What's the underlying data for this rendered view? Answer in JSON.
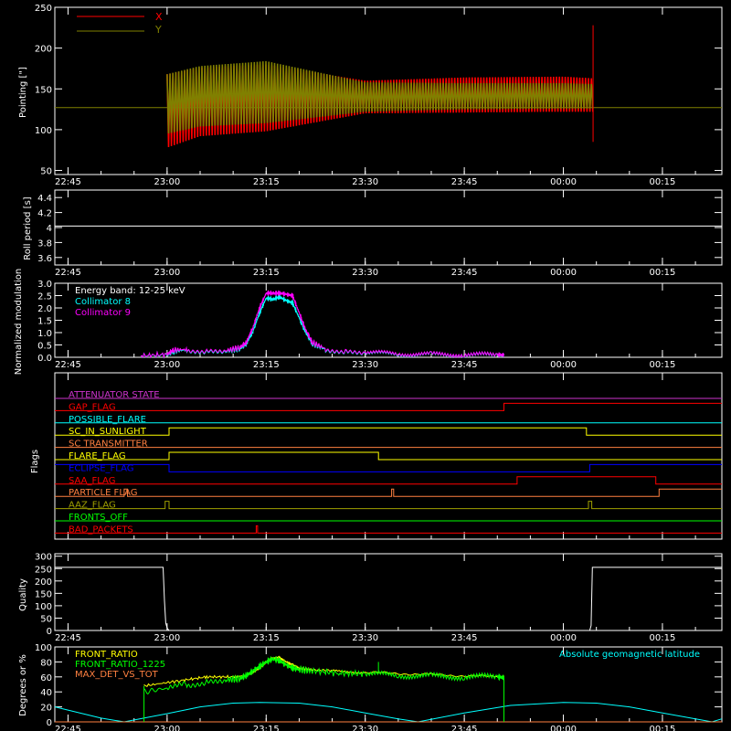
{
  "time_ticks": [
    "22:45",
    "23:00",
    "23:15",
    "23:30",
    "23:45",
    "00:00",
    "00:15"
  ],
  "colors": {
    "x": "#ff0000",
    "y": "#808000",
    "white": "#ffffff",
    "cyan": "#00ffff",
    "magenta": "#ff00ff",
    "green": "#00ff00",
    "yellow": "#ffff00",
    "orange": "#ff8040",
    "blue": "#0000ff",
    "purple": "#cc33cc",
    "olive": "#a0a000"
  },
  "chart_data": [
    {
      "id": "pointing",
      "type": "line",
      "ylabel": "Pointing [\"]",
      "ylim": [
        45,
        250
      ],
      "yticks": [
        50,
        100,
        150,
        200,
        250
      ],
      "x_range_minutes": [
        -17,
        84
      ],
      "series": [
        {
          "name": "X",
          "color": "#ff0000",
          "band": {
            "x": [
              0,
              5,
              15,
              30,
              45,
              60,
              64.5
            ],
            "lower": [
              78,
              92,
              98,
              120,
              121,
              122,
              122
            ],
            "upper": [
              168,
              176,
              180,
              160,
              164,
              165,
              163
            ]
          }
        },
        {
          "name": "Y",
          "color": "#808000",
          "band": {
            "x": [
              0,
              5,
              15,
              30,
              45,
              60,
              64.5
            ],
            "lower": [
              95,
              104,
              108,
              122,
              125,
              126,
              126
            ],
            "upper": [
              168,
              178,
              184,
              158,
              157,
              157,
              156
            ]
          }
        }
      ],
      "reference_line": 127,
      "spike": {
        "x": 64.5,
        "min": 85,
        "max": 228
      }
    },
    {
      "id": "roll-period",
      "type": "line",
      "ylabel": "Roll period [s]",
      "ylim": [
        3.5,
        4.5
      ],
      "yticks": [
        3.6,
        3.8,
        4.0,
        4.2,
        4.4
      ],
      "series": [
        {
          "color": "#ffffff",
          "x": [
            -17,
            84
          ],
          "y": [
            4.02,
            4.02
          ]
        }
      ]
    },
    {
      "id": "modulation",
      "type": "line",
      "ylabel": "Normalized modulation",
      "ylim": [
        0,
        3
      ],
      "yticks": [
        "0.0",
        "0.5",
        "1.0",
        "1.5",
        "2.0",
        "2.5",
        "3.0"
      ],
      "annotation": "Energy band: 12-25 keV",
      "series": [
        {
          "name": "Collimator 8",
          "color": "#00ffff",
          "x": [
            -4,
            0,
            1,
            3,
            6,
            9,
            11,
            12,
            13,
            14,
            15,
            16,
            17,
            18,
            19,
            20,
            21,
            22,
            24,
            27,
            30,
            35,
            40,
            45,
            50,
            51
          ],
          "y": [
            0.05,
            0.1,
            0.25,
            0.3,
            0.22,
            0.25,
            0.35,
            0.55,
            1.05,
            1.8,
            2.4,
            2.35,
            2.45,
            2.3,
            2.2,
            1.6,
            1.0,
            0.55,
            0.32,
            0.22,
            0.18,
            0.13,
            0.11,
            0.1,
            0.09,
            0.08
          ]
        },
        {
          "name": "Collimator 9",
          "color": "#ff00ff",
          "x": [
            -4,
            0,
            1,
            3,
            6,
            9,
            11,
            12,
            13,
            14,
            15,
            16,
            17,
            18,
            19,
            20,
            21,
            22,
            24,
            27,
            30,
            35,
            40,
            45,
            50,
            51
          ],
          "y": [
            0.05,
            0.12,
            0.3,
            0.32,
            0.25,
            0.28,
            0.4,
            0.6,
            1.2,
            2.0,
            2.6,
            2.6,
            2.6,
            2.55,
            2.5,
            1.8,
            1.1,
            0.6,
            0.35,
            0.24,
            0.2,
            0.15,
            0.12,
            0.11,
            0.1,
            0.09
          ]
        }
      ]
    },
    {
      "id": "flags",
      "type": "line",
      "ylabel": "Flags",
      "flags": [
        {
          "name": "ATTENUATOR STATE",
          "color": "#cc33cc",
          "steps": [
            [
              -17,
              0
            ]
          ]
        },
        {
          "name": "GAP_FLAG",
          "color": "#ff0000",
          "steps": [
            [
              -17,
              0
            ],
            [
              51,
              1
            ]
          ]
        },
        {
          "name": "POSSIBLE_FLARE",
          "color": "#00ffff",
          "steps": [
            [
              -17,
              0
            ]
          ]
        },
        {
          "name": "SC_IN_SUNLIGHT",
          "color": "#ffff00",
          "steps": [
            [
              -17,
              0
            ],
            [
              0.3,
              1
            ],
            [
              63.5,
              0
            ]
          ]
        },
        {
          "name": "SC TRANSMITTER",
          "color": "#ff8040",
          "steps": [
            [
              -17,
              0
            ]
          ]
        },
        {
          "name": "FLARE_FLAG",
          "color": "#ffff00",
          "steps": [
            [
              -17,
              0
            ],
            [
              0.3,
              1
            ],
            [
              32,
              0
            ]
          ]
        },
        {
          "name": "ECLIPSE_FLAG",
          "color": "#0000ff",
          "steps": [
            [
              -17,
              1
            ],
            [
              0.3,
              0
            ],
            [
              64,
              1
            ]
          ]
        },
        {
          "name": "SAA_FLAG",
          "color": "#ff0000",
          "steps": [
            [
              -17,
              0
            ],
            [
              53,
              1
            ],
            [
              74,
              0
            ]
          ]
        },
        {
          "name": "PARTICLE FLAG",
          "color": "#ff8040",
          "steps": [
            [
              -17,
              0
            ],
            [
              -6.5,
              1
            ],
            [
              -6,
              0
            ],
            [
              34,
              1
            ],
            [
              34.3,
              0
            ],
            [
              74.5,
              1
            ],
            [
              84,
              1
            ]
          ]
        },
        {
          "name": "AAZ_FLAG",
          "color": "#a0a000",
          "steps": [
            [
              -17,
              0
            ],
            [
              -0.3,
              1
            ],
            [
              0.3,
              0
            ],
            [
              63.8,
              1
            ],
            [
              64.3,
              0
            ]
          ]
        },
        {
          "name": "FRONTS_OFF",
          "color": "#00ff00",
          "steps": [
            [
              -17,
              0
            ]
          ]
        },
        {
          "name": "BAD_PACKETS",
          "color": "#ff0000",
          "steps": [
            [
              -17,
              0
            ],
            [
              13.5,
              1
            ],
            [
              13.7,
              0
            ]
          ]
        }
      ]
    },
    {
      "id": "quality",
      "type": "line",
      "ylabel": "Quality",
      "ylim": [
        0,
        310
      ],
      "yticks": [
        0,
        50,
        100,
        150,
        200,
        250,
        300
      ],
      "series": [
        {
          "color": "#ffffff",
          "x": [
            -17,
            -0.6,
            -0.4,
            -0.2,
            0,
            0.3,
            64,
            64.2,
            64.4,
            84
          ],
          "y": [
            255,
            255,
            120,
            30,
            10,
            0,
            0,
            20,
            255,
            255
          ]
        }
      ]
    },
    {
      "id": "ratios",
      "type": "line",
      "ylabel": "Degrees or %",
      "ylim": [
        0,
        100
      ],
      "yticks": [
        0,
        20,
        40,
        60,
        80,
        100
      ],
      "right_label": "Absolute geomagnetic latitude",
      "series": [
        {
          "name": "FRONT_RATIO",
          "color": "#ffff00",
          "x": [
            -3.5,
            2,
            6,
            10,
            12,
            13,
            14,
            15,
            16,
            17,
            18,
            19,
            20,
            22,
            25,
            30,
            40,
            50,
            51
          ],
          "y": [
            48,
            55,
            60,
            60,
            62,
            66,
            72,
            80,
            85,
            86,
            80,
            76,
            72,
            70,
            68,
            66,
            63,
            60,
            60
          ]
        },
        {
          "name": "FRONT_RATIO_1225",
          "color": "#00ff00",
          "x": [
            -3.5,
            0,
            3,
            6,
            9,
            11,
            12,
            13,
            14,
            15,
            16,
            17,
            18,
            19,
            20,
            22,
            26,
            30,
            35,
            40,
            45,
            50,
            51
          ],
          "y": [
            40,
            45,
            50,
            53,
            56,
            58,
            62,
            68,
            74,
            80,
            84,
            82,
            76,
            72,
            70,
            68,
            65,
            64,
            62,
            61,
            60,
            60,
            59
          ]
        },
        {
          "name": "MAX_DET_VS_TOT",
          "color": "#ff8040",
          "x": [
            -17,
            84
          ],
          "y": [
            0,
            0
          ]
        },
        {
          "name": "Absolute geomagnetic latitude",
          "color": "#00ffff",
          "kind": "latitude",
          "x": [
            -17,
            -10,
            -6.5,
            0,
            5,
            10,
            14,
            20,
            25,
            30,
            35,
            38,
            45,
            52,
            60,
            65,
            70,
            75,
            80,
            82.5,
            84
          ],
          "y": [
            20,
            5,
            0,
            11,
            20,
            25,
            26,
            25,
            20,
            12,
            4,
            0,
            12,
            22,
            26,
            25,
            20,
            12,
            4,
            0,
            4
          ]
        }
      ]
    }
  ]
}
